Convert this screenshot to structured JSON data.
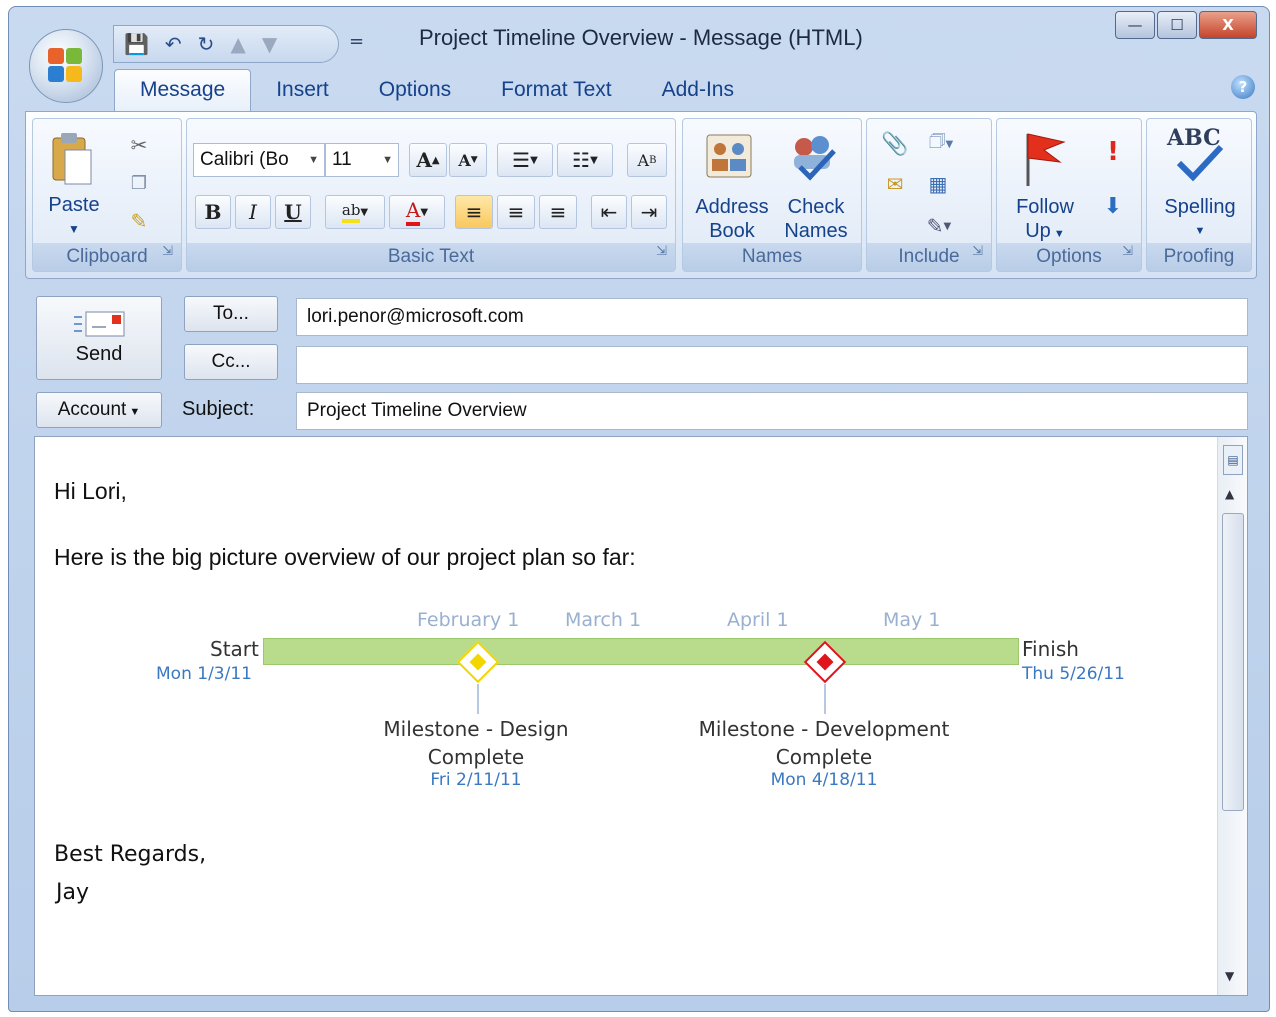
{
  "window": {
    "title": "Project Timeline Overview - Message (HTML)",
    "controls": {
      "minimize": "—",
      "maximize": "☐",
      "close": "X"
    }
  },
  "qat": {
    "more": "="
  },
  "tabs": [
    "Message",
    "Insert",
    "Options",
    "Format Text",
    "Add-Ins"
  ],
  "ribbon": {
    "clipboard": {
      "label": "Clipboard",
      "paste": "Paste"
    },
    "basic_text": {
      "label": "Basic Text",
      "font": "Calibri (Bo",
      "size": "11"
    },
    "names": {
      "label": "Names",
      "address_book": [
        "Address",
        "Book"
      ],
      "check_names": [
        "Check",
        "Names"
      ]
    },
    "include": {
      "label": "Include"
    },
    "options": {
      "label": "Options",
      "follow_up": [
        "Follow",
        "Up"
      ]
    },
    "proofing": {
      "label": "Proofing",
      "spelling": "Spelling",
      "abc": "ABC"
    }
  },
  "header": {
    "send": "Send",
    "to_button": "To...",
    "cc_button": "Cc...",
    "account": "Account",
    "subject_label": "Subject:",
    "to_value": "lori.penor@microsoft.com",
    "cc_value": "",
    "subject_value": "Project Timeline Overview"
  },
  "body": {
    "greeting": "Hi Lori,",
    "intro": "Here is the big picture overview of our project plan so far:",
    "closing": "Best Regards,",
    "signature": "Jay"
  },
  "timeline": {
    "months": [
      "February 1",
      "March 1",
      "April 1",
      "May 1"
    ],
    "start": {
      "label": "Start",
      "date": "Mon 1/3/11"
    },
    "finish": {
      "label": "Finish",
      "date": "Thu 5/26/11"
    },
    "milestones": [
      {
        "label_lines": [
          "Milestone - Design",
          "Complete"
        ],
        "date": "Fri 2/11/11",
        "color": "#f2d600"
      },
      {
        "label_lines": [
          "Milestone - Development",
          "Complete"
        ],
        "date": "Mon 4/18/11",
        "color": "#e0141b"
      }
    ],
    "bar_color": "#b8dc8c"
  }
}
